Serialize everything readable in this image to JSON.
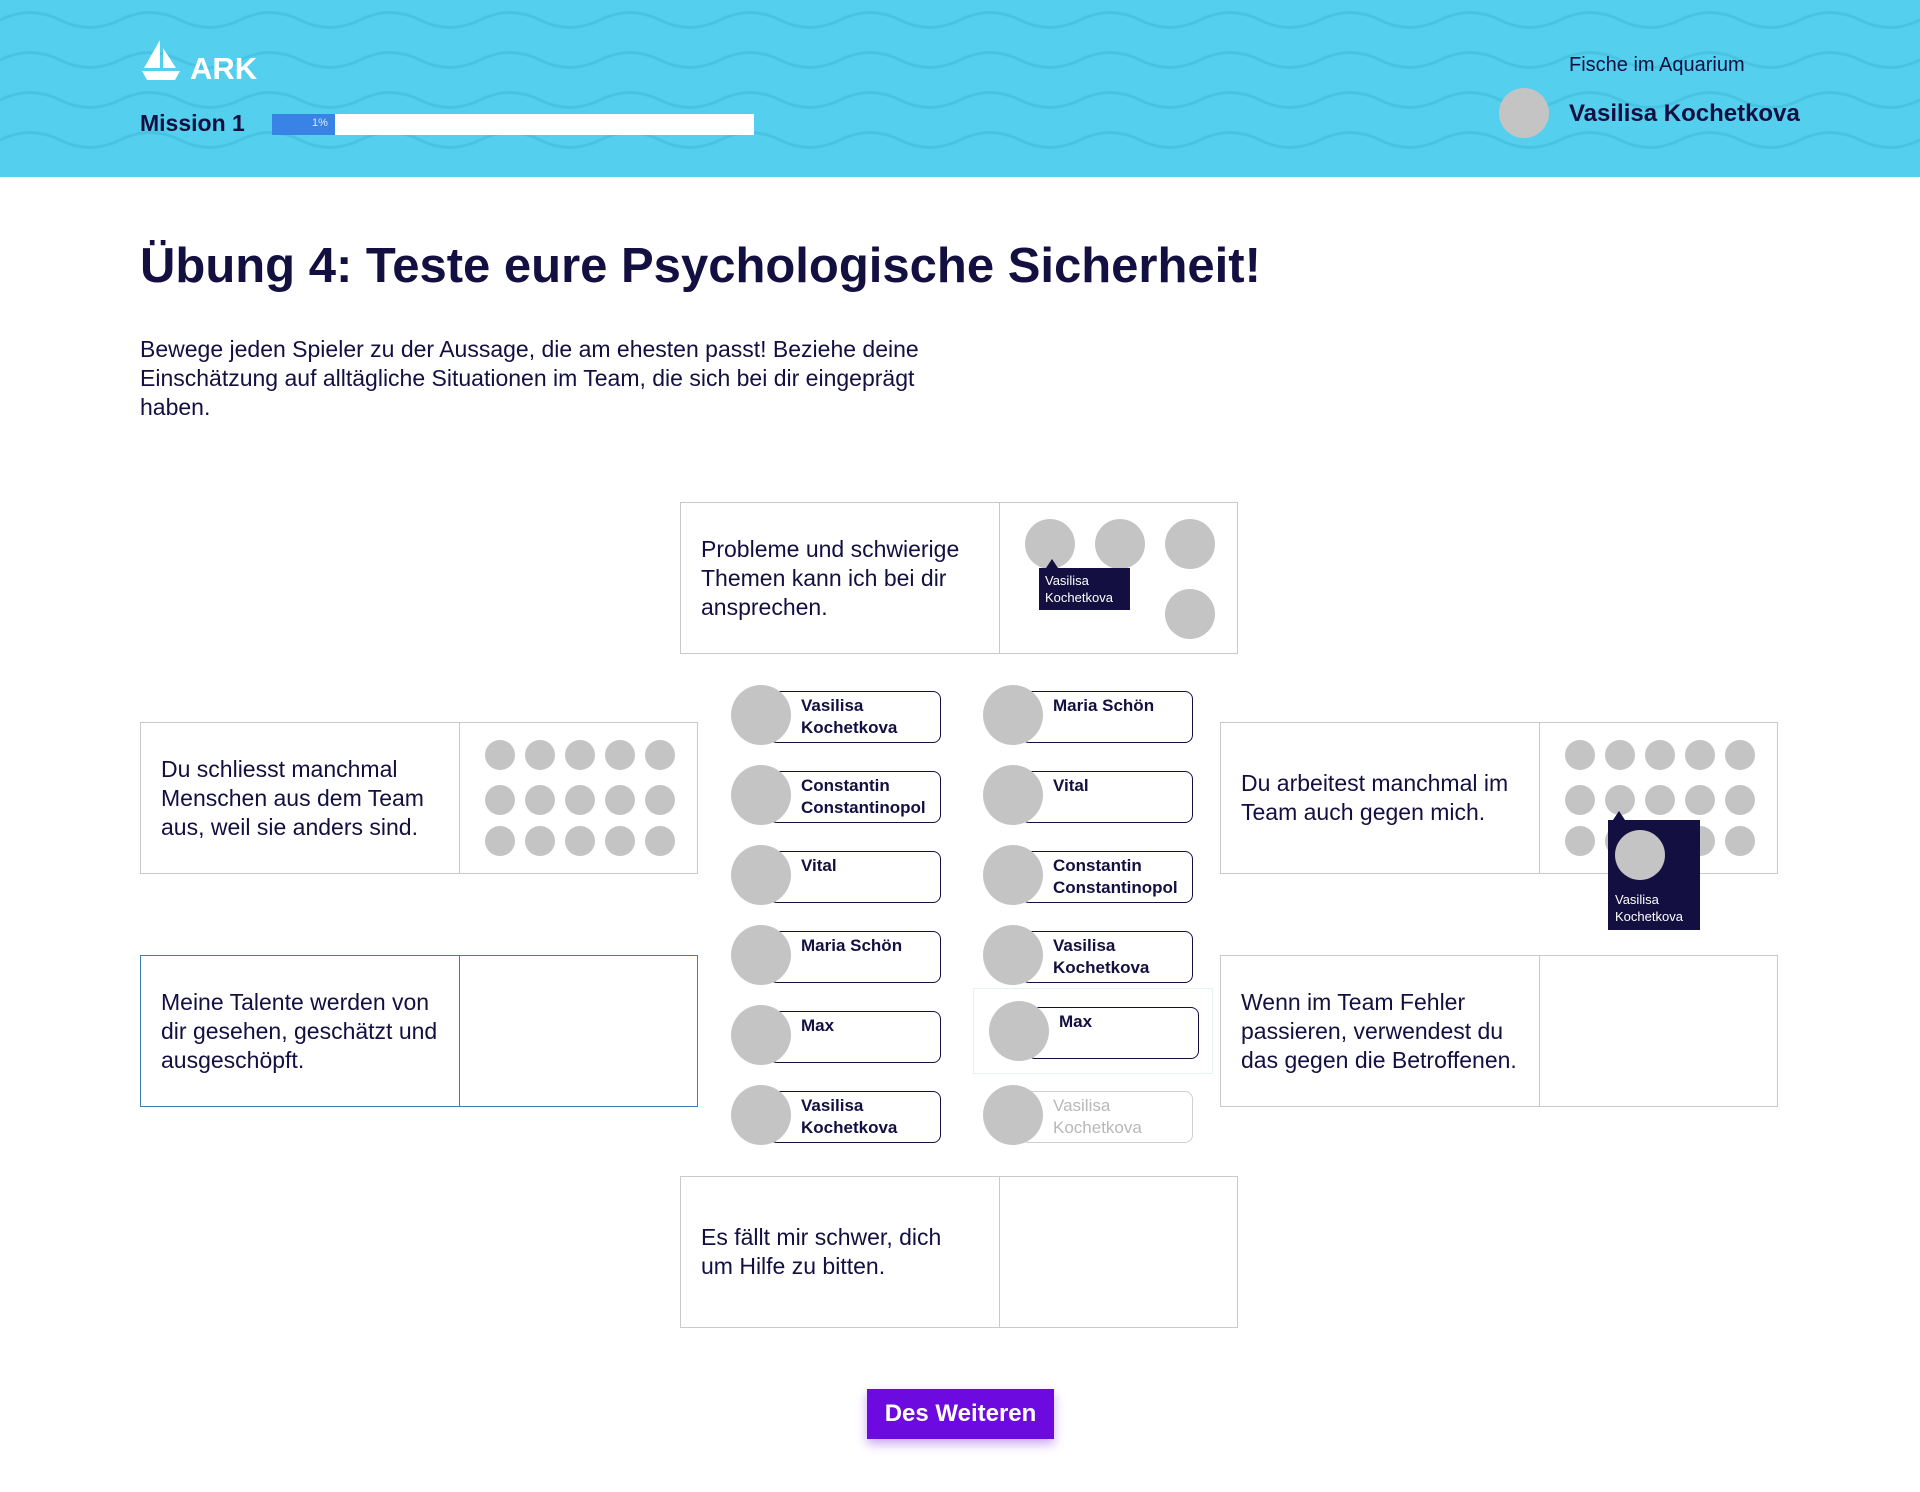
{
  "brand": {
    "logo_text": "ARK"
  },
  "mission": {
    "label": "Mission 1",
    "progress_percent": 1,
    "progress_label": "1%"
  },
  "user": {
    "team": "Fische im Aquarium",
    "name": "Vasilisa Kochetkova"
  },
  "exercise": {
    "title": "Übung 4: Teste eure Psychologische Sicherheit!",
    "description": "Bewege jeden Spieler zu der Aussage, die am ehesten passt! Beziehe deine Einschätzung auf alltägliche Situationen im Team, die sich bei dir eingeprägt haben."
  },
  "statements": [
    {
      "text": "Probleme und schwierige Themen kann ich bei dir ansprechen.",
      "tooltip": "Vasilisa Kochetkova"
    },
    {
      "text": "Du schliesst manchmal Menschen aus dem Team aus, weil sie anders sind."
    },
    {
      "text": "Du arbeitest manchmal im Team auch gegen mich.",
      "tooltip": "Vasilisa Kochetkova"
    },
    {
      "text": "Meine Talente werden von dir gesehen, geschätzt und ausgeschöpft."
    },
    {
      "text": "Wenn im Team Fehler passieren, verwendest du das gegen die Betroffenen."
    },
    {
      "text": "Es fällt mir schwer, dich um Hilfe zu bitten."
    }
  ],
  "players_left": [
    {
      "name": "Vasilisa Kochetkova"
    },
    {
      "name": "Constantin Constantinopol"
    },
    {
      "name": "Vital"
    },
    {
      "name": "Maria Schön"
    },
    {
      "name": "Max"
    },
    {
      "name": "Vasilisa Kochetkova"
    }
  ],
  "players_right": [
    {
      "name": "Maria Schön"
    },
    {
      "name": "Vital"
    },
    {
      "name": "Constantin Constantinopol"
    },
    {
      "name": "Vasilisa Kochetkova"
    },
    {
      "name": "Max"
    },
    {
      "name": "Vasilisa Kochetkova"
    }
  ],
  "actions": {
    "next_label": "Des Weiteren"
  },
  "colors": {
    "header": "#54cfee",
    "navy": "#130f40",
    "progress": "#3a83e6",
    "button": "#6c0ae0",
    "avatar": "#c4c4c4"
  }
}
